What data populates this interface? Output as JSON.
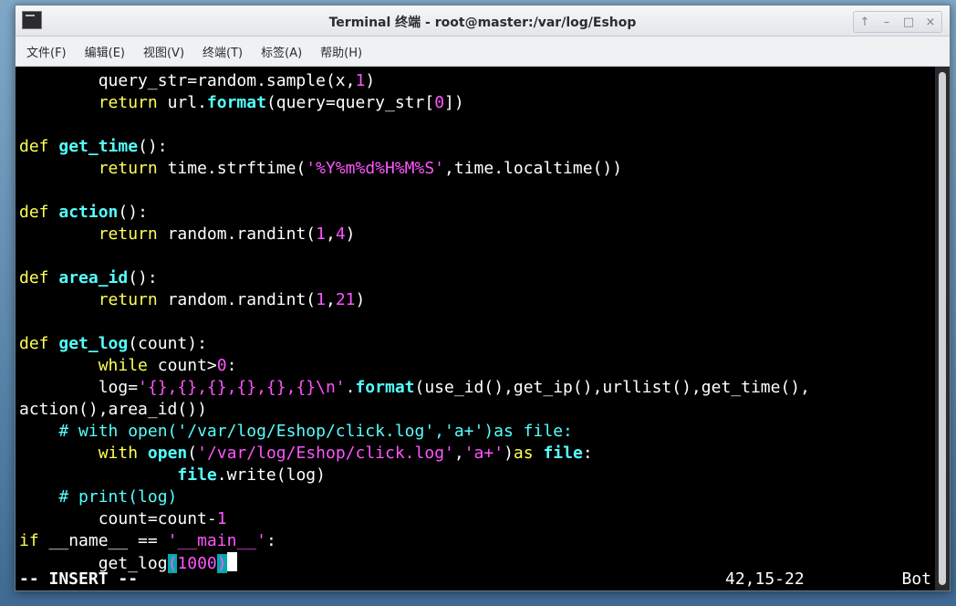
{
  "window": {
    "title": "Terminal 终端 - root@master:/var/log/Eshop",
    "buttons": [
      "↑",
      "–",
      "□",
      "×"
    ]
  },
  "menu": [
    "文件(F)",
    "编辑(E)",
    "视图(V)",
    "终端(T)",
    "标签(A)",
    "帮助(H)"
  ],
  "code": {
    "l01": {
      "a": "        query_str=random.sample(x,",
      "b": "1",
      "c": ")"
    },
    "l02": {
      "a": "        ",
      "b": "return",
      "c": " url.",
      "d": "format",
      "e": "(query=query_str[",
      "f": "0",
      "g": "])"
    },
    "l04": {
      "a": "def",
      "b": " ",
      "c": "get_time",
      "d": "():"
    },
    "l05": {
      "a": "        ",
      "b": "return",
      "c": " time.strftime(",
      "d": "'%Y%m%d%H%M%S'",
      "e": ",time.localtime())"
    },
    "l07": {
      "a": "def",
      "b": " ",
      "c": "action",
      "d": "():"
    },
    "l08": {
      "a": "        ",
      "b": "return",
      "c": " random.randint(",
      "d": "1",
      "e": ",",
      "f": "4",
      "g": ")"
    },
    "l10": {
      "a": "def",
      "b": " ",
      "c": "area_id",
      "d": "():"
    },
    "l11": {
      "a": "        ",
      "b": "return",
      "c": " random.randint(",
      "d": "1",
      "e": ",",
      "f": "21",
      "g": ")"
    },
    "l13": {
      "a": "def",
      "b": " ",
      "c": "get_log",
      "d": "(count):"
    },
    "l14": {
      "a": "        ",
      "b": "while",
      "c": " count>",
      "d": "0",
      "e": ":"
    },
    "l15": {
      "a": "        log=",
      "b": "'{},{},{},{},{},{}\\n'",
      "c": ".",
      "d": "format",
      "e": "(use_id(),get_ip(),urllist(),get_time(),"
    },
    "l16": {
      "a": "action(),area_id())"
    },
    "l17": {
      "a": "    # with open('/var/log/Eshop/click.log','a+')as file:"
    },
    "l18": {
      "a": "        ",
      "b": "with",
      "c": " ",
      "d": "open",
      "e": "(",
      "f": "'/var/log/Eshop/click.log'",
      "g": ",",
      "h": "'a+'",
      "i": ")",
      "j": "as",
      "k": " ",
      "l": "file",
      "m": ":"
    },
    "l19": {
      "a": "                ",
      "b": "file",
      "c": ".write(log)"
    },
    "l20": {
      "a": "    # print(log)"
    },
    "l21": {
      "a": "        count=count-",
      "b": "1"
    },
    "l22": {
      "a": "if",
      "b": " __name__ == ",
      "c": "'__main__'",
      "d": ":"
    },
    "l23": {
      "a": "        get_log",
      "b": "(",
      "c": "1000",
      "d": ")"
    }
  },
  "status": {
    "mode": "-- INSERT --",
    "position": "42,15-22",
    "scroll": "Bot"
  }
}
